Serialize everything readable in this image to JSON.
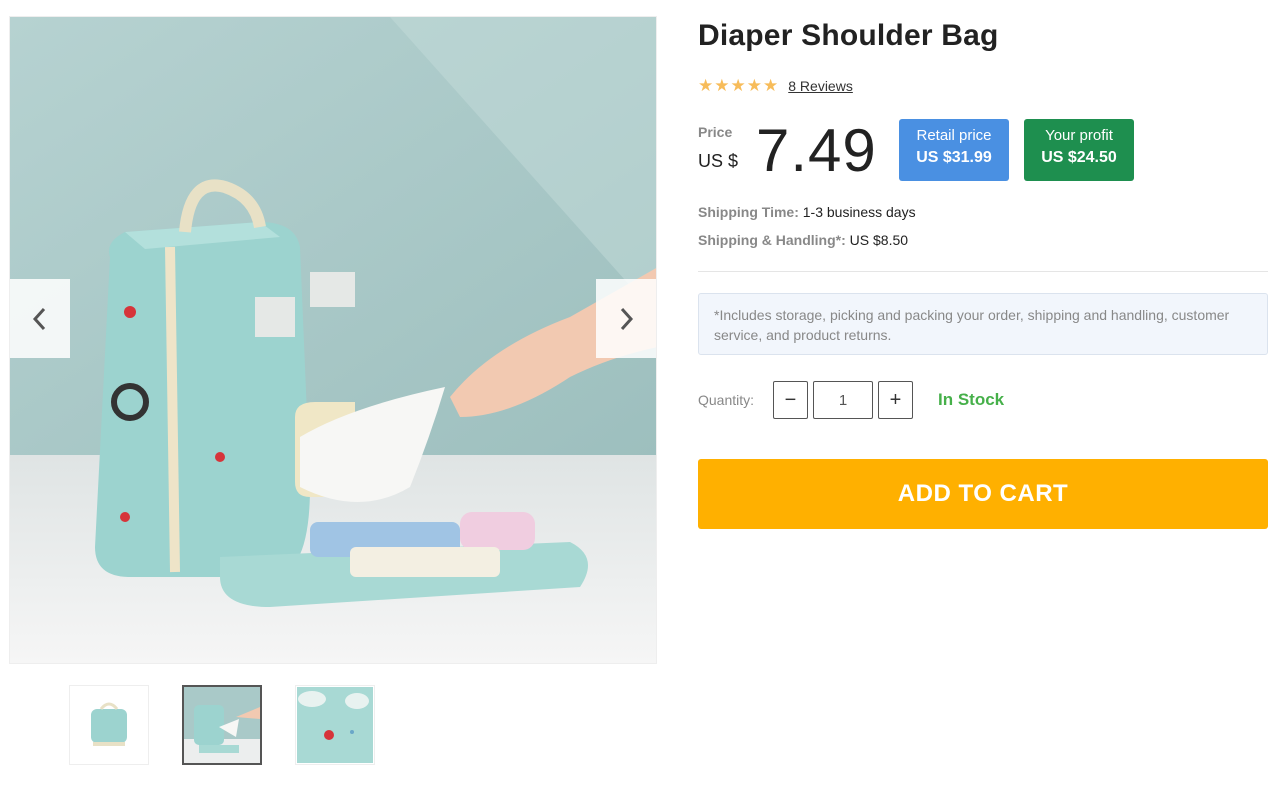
{
  "product": {
    "title": "Diaper Shoulder Bag",
    "rating": 5,
    "reviews_label": "8 Reviews"
  },
  "gallery": {
    "prev_icon": "chevron-left-icon",
    "next_icon": "chevron-right-icon",
    "thumbnails": [
      "bag-front",
      "bag-with-tissue",
      "pattern-closeup"
    ],
    "active_index": 1
  },
  "price": {
    "label": "Price",
    "currency": "US $",
    "value": "7.49",
    "retail_label": "Retail price",
    "retail_value": "US $31.99",
    "profit_label": "Your profit",
    "profit_value": "US $24.50"
  },
  "shipping": {
    "time_label": "Shipping Time:",
    "time_value": "1-3 business days",
    "handling_label": "Shipping & Handling*:",
    "handling_value": "US $8.50"
  },
  "note": "*Includes storage, picking and packing your order, shipping and handling, customer service, and product returns.",
  "quantity": {
    "label": "Quantity:",
    "minus": "−",
    "plus": "+",
    "value": "1"
  },
  "stock_status": "In Stock",
  "cart_button": "ADD TO CART",
  "colors": {
    "retail": "#4a90e2",
    "profit": "#1e8f4f",
    "cart": "#ffb000",
    "stock": "#46b04a",
    "star": "#f5a623"
  }
}
